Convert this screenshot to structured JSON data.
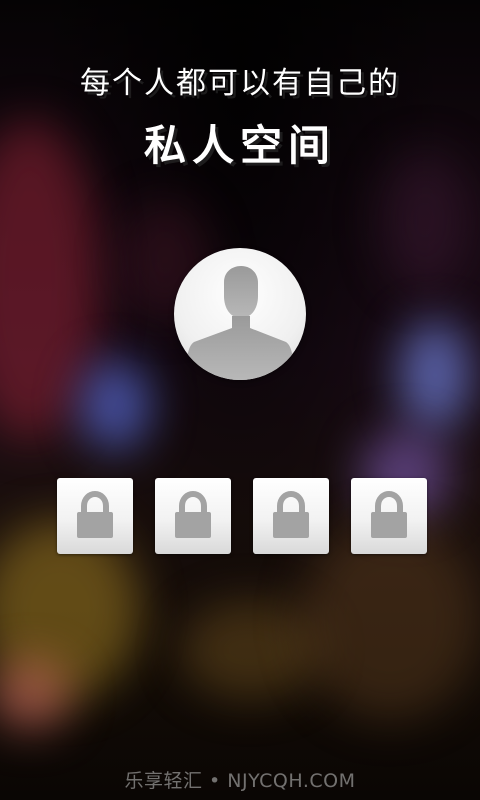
{
  "headline": {
    "line1": "每个人都可以有自己的",
    "line2": "私人空间"
  },
  "avatar": {
    "icon": "person-silhouette-icon"
  },
  "lock_buttons": [
    {
      "icon": "lock-icon"
    },
    {
      "icon": "lock-icon"
    },
    {
      "icon": "lock-icon"
    },
    {
      "icon": "lock-icon"
    }
  ],
  "footer": {
    "text": "乐享轻汇 • NJYCQH.COM"
  },
  "colors": {
    "headline_text": "#ffffff",
    "lock_box_top": "#ffffff",
    "lock_box_bottom": "#d9d9d9",
    "lock_icon": "#a3a3a3",
    "silhouette": "#a9a9a9",
    "footer_text": "#9a9a9a"
  }
}
